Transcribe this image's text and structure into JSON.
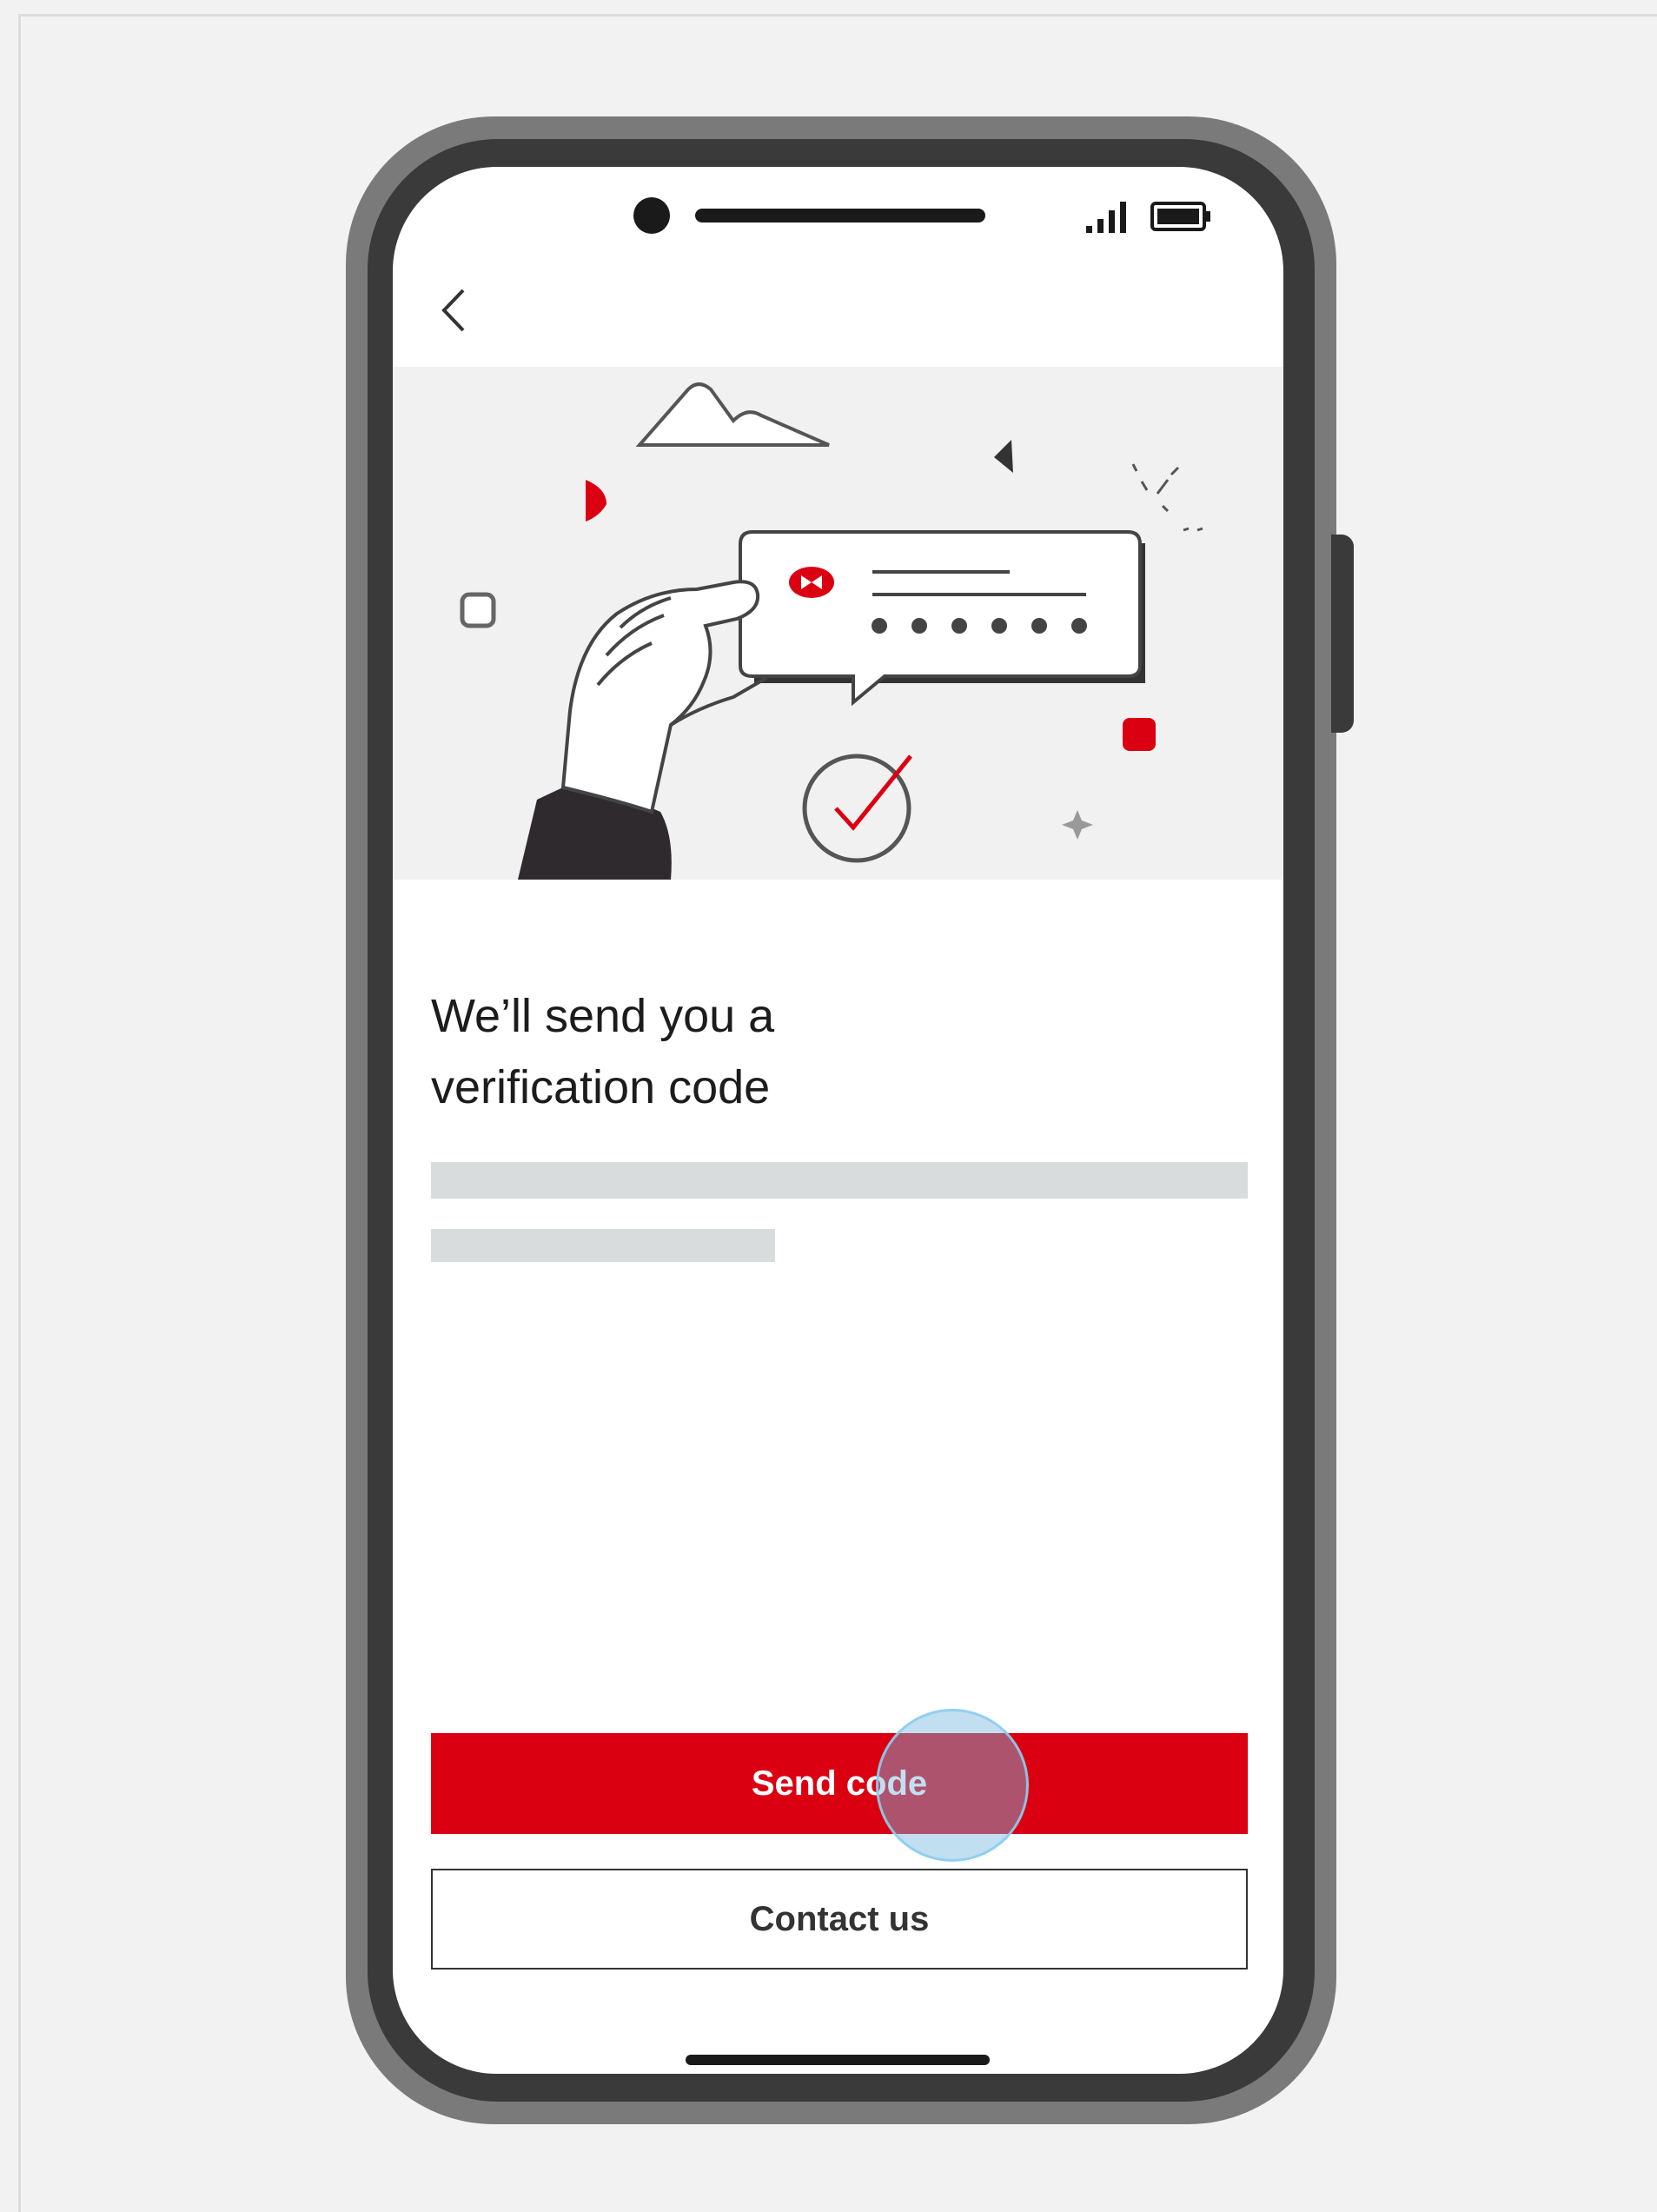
{
  "status_bar": {
    "signal_icon": "cellular-signal-icon",
    "battery_icon": "battery-full-icon"
  },
  "nav": {
    "back_icon": "chevron-left-icon"
  },
  "hero": {
    "illustration": "hand-holding-verification-code-message-illustration",
    "accent_color": "#db0011"
  },
  "content": {
    "heading_line1": "We’ll send you a",
    "heading_line2": "verification code"
  },
  "actions": {
    "send_code_label": "Send code",
    "contact_us_label": "Contact us"
  },
  "colors": {
    "primary": "#db0011",
    "background": "#f2f2f2",
    "text": "#1c1c1c"
  }
}
